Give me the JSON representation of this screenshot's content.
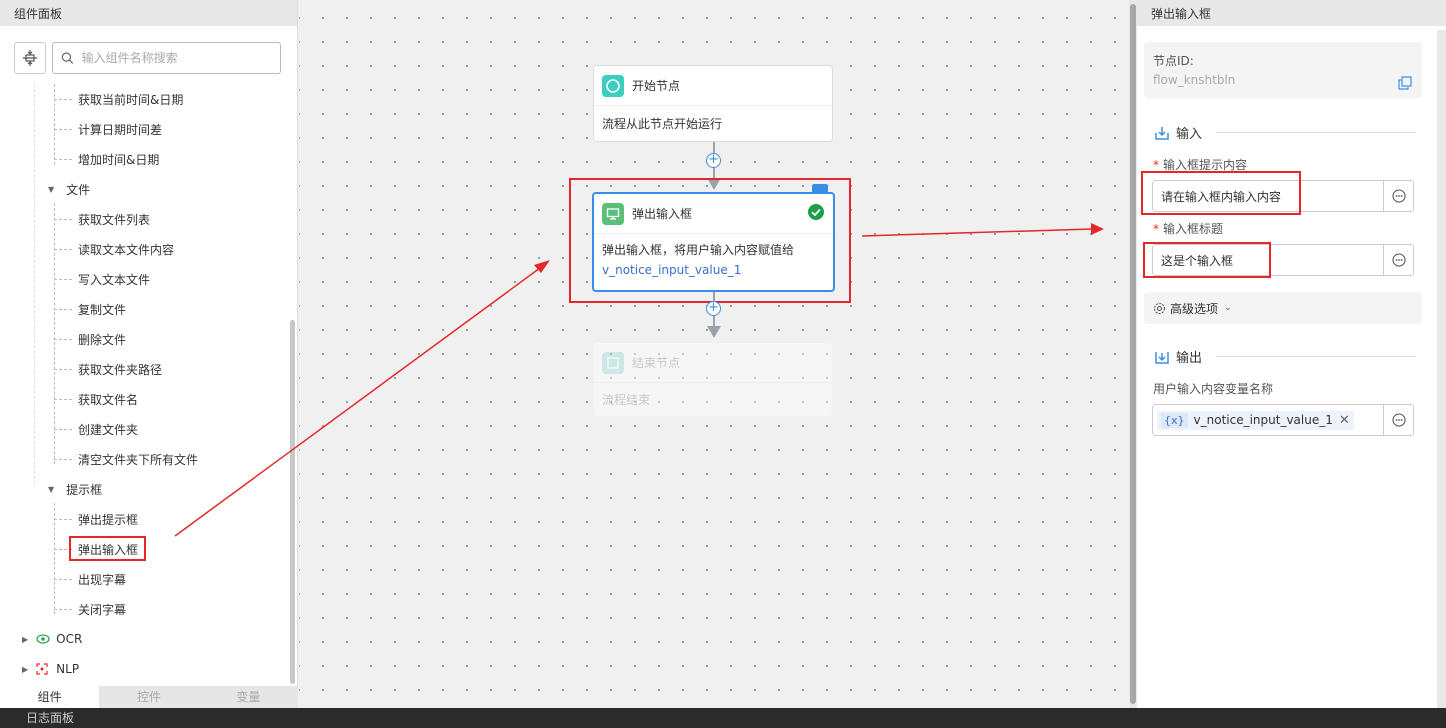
{
  "left_panel": {
    "title": "组件面板",
    "search_placeholder": "输入组件名称搜索",
    "tree": {
      "datetime_items": [
        "获取当前时间&日期",
        "计算日期时间差",
        "增加时间&日期"
      ],
      "file_group": "文件",
      "file_items": [
        "获取文件列表",
        "读取文本文件内容",
        "写入文本文件",
        "复制文件",
        "删除文件",
        "获取文件夹路径",
        "获取文件名",
        "创建文件夹",
        "清空文件夹下所有文件"
      ],
      "dialog_group": "提示框",
      "dialog_items": [
        "弹出提示框",
        "弹出输入框",
        "出现字幕",
        "关闭字幕"
      ],
      "ocr_group": "OCR",
      "nlp_group": "NLP"
    },
    "tabs": [
      "组件",
      "控件",
      "变量"
    ],
    "active_tab": 0
  },
  "canvas": {
    "start_node": {
      "title": "开始节点",
      "body": "流程从此节点开始运行"
    },
    "input_node": {
      "title": "弹出输入框",
      "body": "弹出输入框，将用户输入内容赋值给",
      "var": "v_notice_input_value_1"
    },
    "end_node": {
      "title": "结束节点",
      "body": "流程结束"
    }
  },
  "right_panel": {
    "title": "弹出输入框",
    "node_id_label": "节点ID:",
    "node_id_value": "flow_knshtbln",
    "input_section": "输入",
    "prompt_label": "输入框提示内容",
    "prompt_value": "请在输入框内输入内容",
    "title_label": "输入框标题",
    "title_value": "这是个输入框",
    "advanced_label": "高级选项",
    "output_section": "输出",
    "output_var_label": "用户输入内容变量名称",
    "output_var_badge": "{x}",
    "output_var_value": "v_notice_input_value_1"
  },
  "log_panel": {
    "title": "日志面板"
  },
  "colors": {
    "accent": "#3a8ee6",
    "annotation": "#e4272a",
    "success": "#1f9d4a",
    "start_icon": "#3ccfc0",
    "node_icon": "#5bbf7a"
  }
}
